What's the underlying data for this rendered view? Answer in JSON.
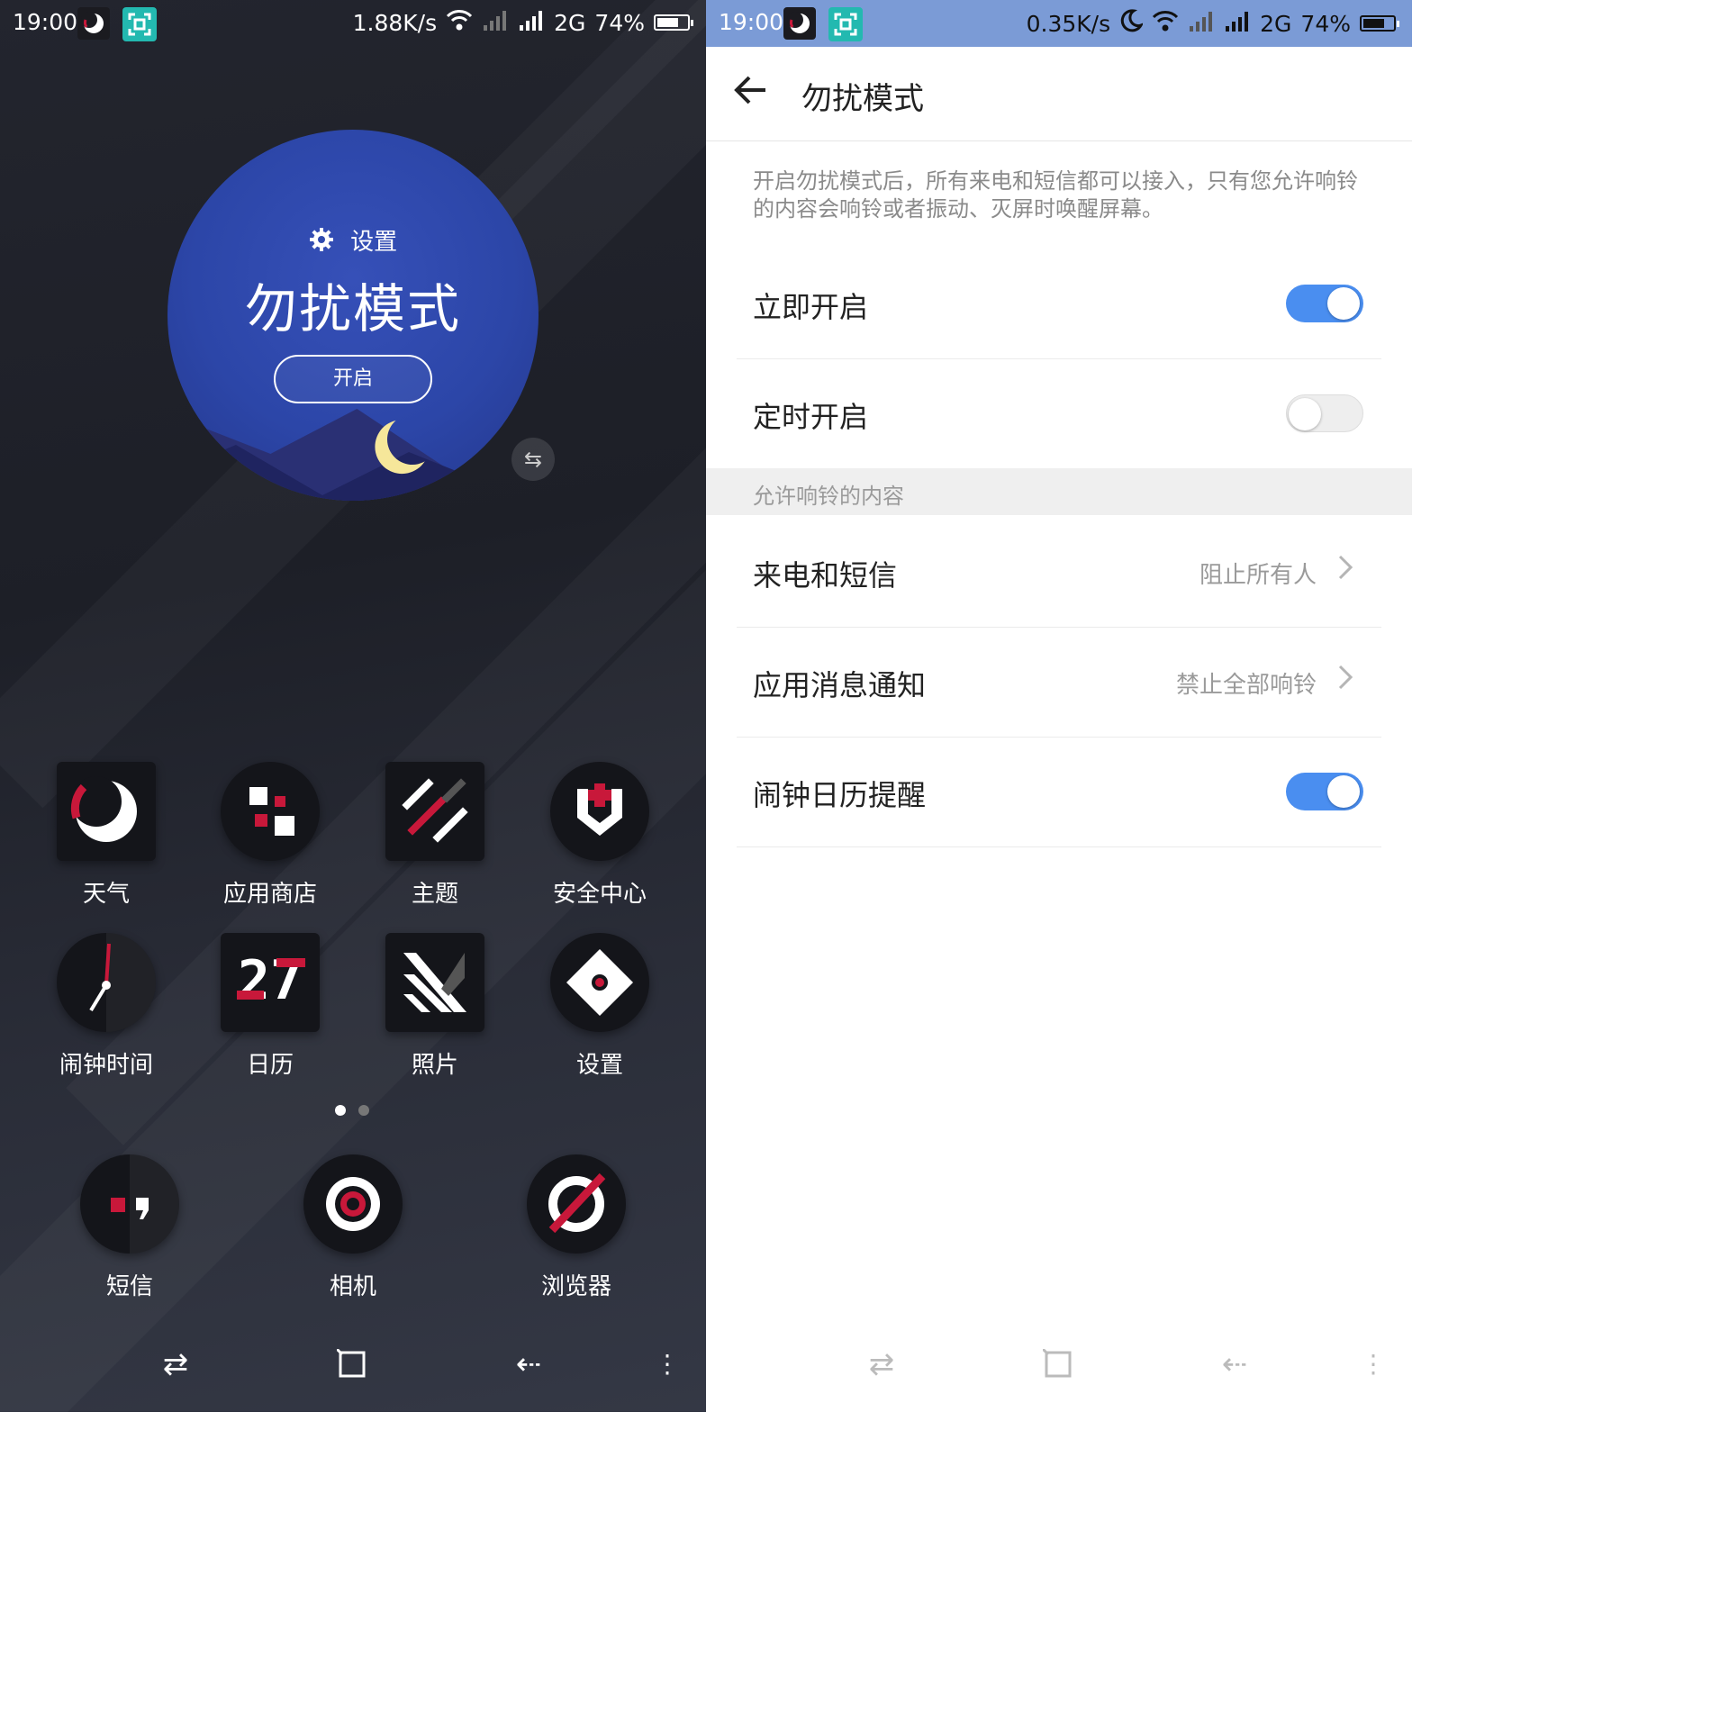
{
  "left": {
    "status": {
      "time": "19:00",
      "speed": "1.88K/s",
      "network": "2G",
      "battery": "74%",
      "battery_level": 0.74
    },
    "widget": {
      "settings_label": "设置",
      "title": "勿扰模式",
      "button": "开启"
    },
    "apps_grid": [
      {
        "label": "天气",
        "icon": "weather-moon-icon"
      },
      {
        "label": "应用商店",
        "icon": "app-store-icon"
      },
      {
        "label": "主题",
        "icon": "theme-icon"
      },
      {
        "label": "安全中心",
        "icon": "security-shield-icon"
      },
      {
        "label": "闹钟时间",
        "icon": "clock-icon"
      },
      {
        "label": "日历",
        "icon": "calendar-icon",
        "icon_text": "27"
      },
      {
        "label": "照片",
        "icon": "photos-icon"
      },
      {
        "label": "设置",
        "icon": "settings-icon"
      }
    ],
    "page_indicator": {
      "pages": 2,
      "active": 0
    },
    "dock": [
      {
        "label": "短信",
        "icon": "messages-icon"
      },
      {
        "label": "相机",
        "icon": "camera-icon"
      },
      {
        "label": "浏览器",
        "icon": "browser-icon"
      }
    ]
  },
  "right": {
    "status": {
      "time": "19:00",
      "speed": "0.35K/s",
      "network": "2G",
      "battery": "74%",
      "battery_level": 0.74
    },
    "header": {
      "title": "勿扰模式"
    },
    "description": "开启勿扰模式后，所有来电和短信都可以接入，只有您允许响铃的内容会响铃或者振动、灭屏时唤醒屏幕。",
    "rows_top": [
      {
        "label": "立即开启",
        "on": true
      },
      {
        "label": "定时开启",
        "on": false
      }
    ],
    "section_header": "允许响铃的内容",
    "rows_bottom": [
      {
        "label": "来电和短信",
        "value": "阻止所有人"
      },
      {
        "label": "应用消息通知",
        "value": "禁止全部响铃"
      },
      {
        "label": "闹钟日历提醒",
        "on": true
      }
    ]
  },
  "colors": {
    "accent": "#4a8ef0",
    "status_bar_right": "#7b9bd6",
    "scan_chip": "#23b9b0",
    "brand_red": "#c8183a"
  }
}
